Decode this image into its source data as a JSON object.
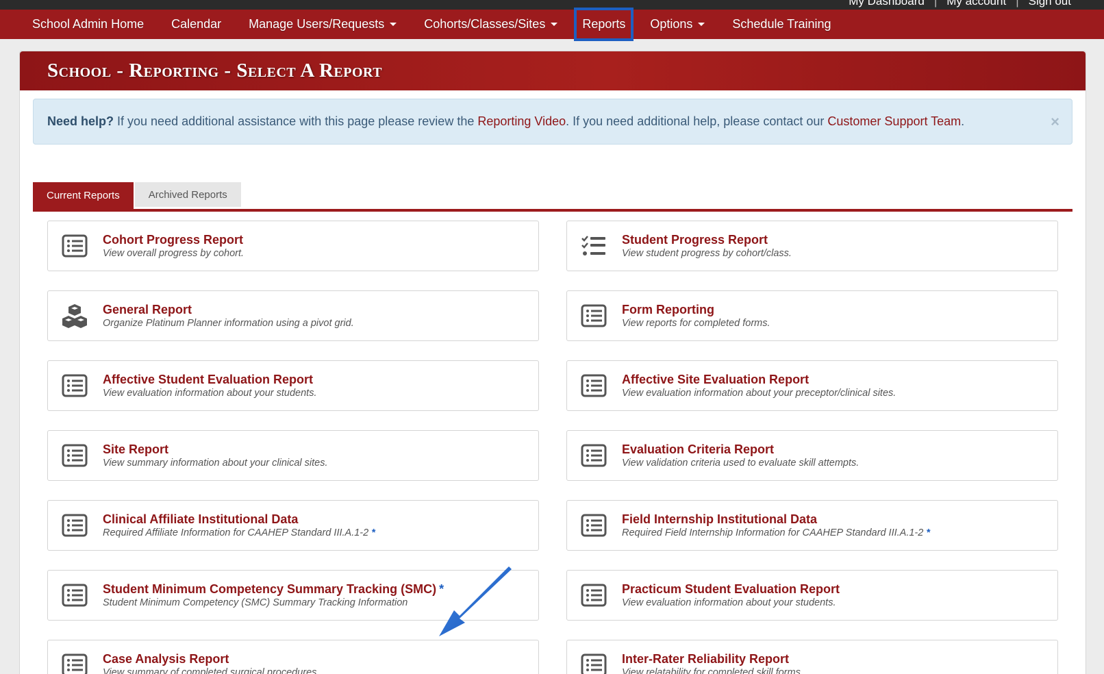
{
  "topbar": {
    "links": [
      "My Dashboard",
      "My account",
      "Sign out"
    ]
  },
  "nav": {
    "items": [
      {
        "label": "School Admin Home",
        "dropdown": false
      },
      {
        "label": "Calendar",
        "dropdown": false
      },
      {
        "label": "Manage Users/Requests",
        "dropdown": true
      },
      {
        "label": "Cohorts/Classes/Sites",
        "dropdown": true
      },
      {
        "label": "Reports",
        "dropdown": false,
        "highlighted": true
      },
      {
        "label": "Options",
        "dropdown": true
      },
      {
        "label": "Schedule Training",
        "dropdown": false
      }
    ]
  },
  "page": {
    "title": "School - Reporting - Select A Report"
  },
  "alert": {
    "lead": "Need help?",
    "text1": "If you need additional assistance with this page please review the",
    "link1": "Reporting Video",
    "text2": ". If you need additional help, please contact our",
    "link2": "Customer Support Team",
    "text3": ".",
    "close": "×"
  },
  "tabs": [
    {
      "label": "Current Reports",
      "active": true
    },
    {
      "label": "Archived Reports",
      "active": false
    }
  ],
  "reports": [
    {
      "title": "Cohort Progress Report",
      "desc": "View overall progress by cohort.",
      "icon": "list-icon",
      "star": ""
    },
    {
      "title": "Student Progress Report",
      "desc": "View student progress by cohort/class.",
      "icon": "checklist-icon",
      "star": ""
    },
    {
      "title": "General Report",
      "desc": "Organize Platinum Planner information using a pivot grid.",
      "icon": "cubes-icon",
      "star": ""
    },
    {
      "title": "Form Reporting",
      "desc": "View reports for completed forms.",
      "icon": "list-icon",
      "star": ""
    },
    {
      "title": "Affective Student Evaluation Report",
      "desc": "View evaluation information about your students.",
      "icon": "list-icon",
      "star": ""
    },
    {
      "title": "Affective Site Evaluation Report",
      "desc": "View evaluation information about your preceptor/clinical sites.",
      "icon": "list-icon",
      "star": ""
    },
    {
      "title": "Site Report",
      "desc": "View summary information about your clinical sites.",
      "icon": "list-icon",
      "star": ""
    },
    {
      "title": "Evaluation Criteria Report",
      "desc": "View validation criteria used to evaluate skill attempts.",
      "icon": "list-icon",
      "star": ""
    },
    {
      "title": "Clinical Affiliate Institutional Data",
      "desc": "Required Affiliate Information for CAAHEP Standard III.A.1-2",
      "icon": "list-icon",
      "star": "*",
      "desc_star": true
    },
    {
      "title": "Field Internship Institutional Data",
      "desc": "Required Field Internship Information for CAAHEP Standard III.A.1-2",
      "icon": "list-icon",
      "star": "*",
      "desc_star": true
    },
    {
      "title": "Student Minimum Competency Summary Tracking (SMC)",
      "desc": "Student Minimum Competency (SMC) Summary Tracking Information",
      "icon": "list-icon",
      "star": "*",
      "title_star": true
    },
    {
      "title": "Practicum Student Evaluation Report",
      "desc": "View evaluation information about your students.",
      "icon": "list-icon",
      "star": ""
    },
    {
      "title": "Case Analysis Report",
      "desc": "View summary of completed surgical procedures.",
      "icon": "list-icon",
      "star": ""
    },
    {
      "title": "Inter-Rater Reliability Report",
      "desc": "View relatability for completed skill forms.",
      "icon": "list-icon",
      "star": ""
    }
  ],
  "colors": {
    "brand": "#9c1b1d",
    "link": "#8e1517",
    "highlight": "#1d5fc2",
    "alert_bg": "#dcebf5"
  },
  "annotation": {
    "arrow": "blue-arrow-pointer"
  }
}
